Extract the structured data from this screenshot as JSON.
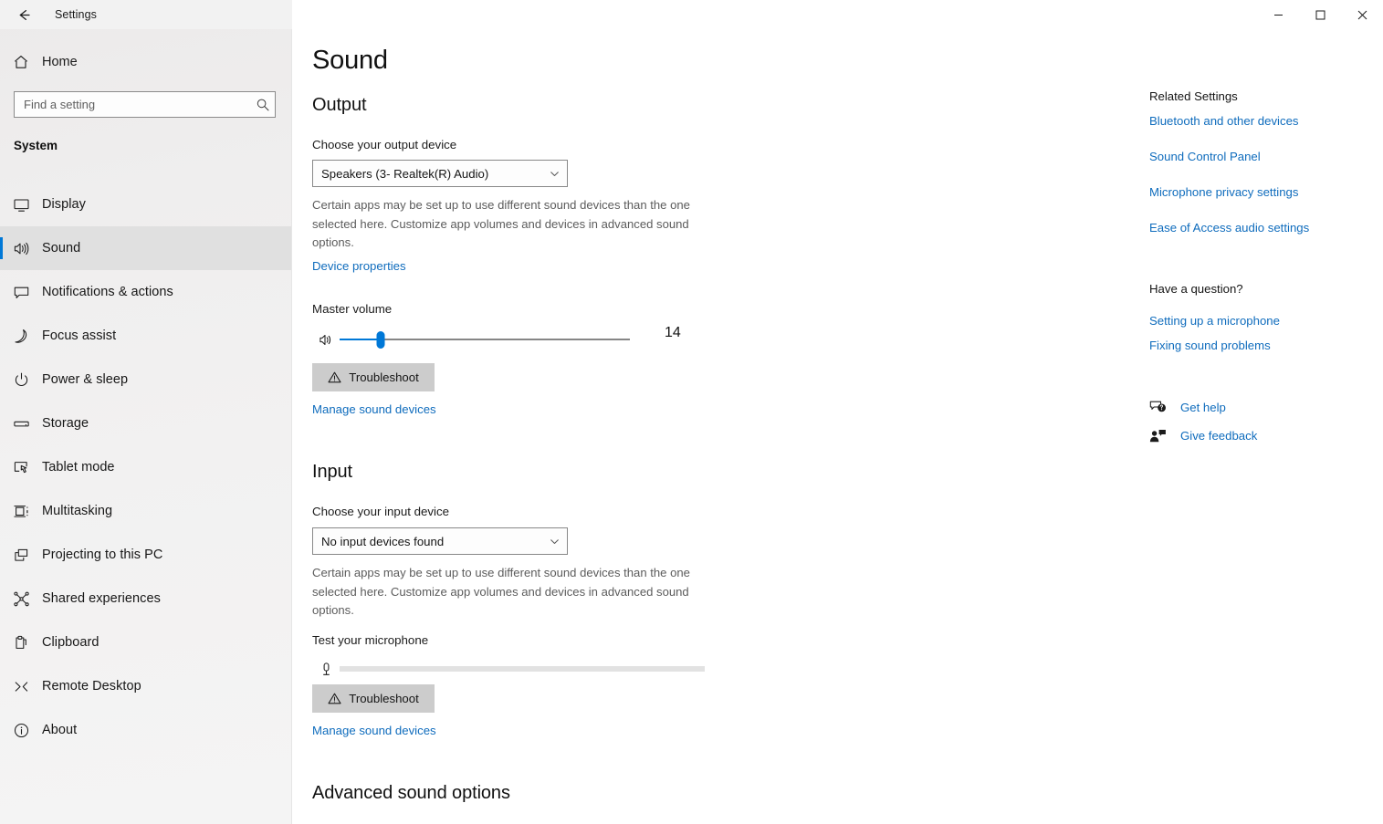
{
  "colors": {
    "accent": "#0078d7",
    "link": "#0f6cbd",
    "sidebar_bg": "#f1f0f0",
    "button_bg": "#cccccc",
    "body_bg": "#ffffff",
    "note_text": "#5c5c5c"
  },
  "titlebar": {
    "title": "Settings",
    "back_icon": "back-arrow-icon",
    "minimize_icon": "minimize-icon",
    "maximize_icon": "maximize-icon",
    "close_icon": "close-icon"
  },
  "sidebar": {
    "home_label": "Home",
    "home_icon": "home-icon",
    "search": {
      "placeholder": "Find a setting",
      "value": "",
      "icon": "search-icon"
    },
    "section_title": "System",
    "items": [
      {
        "label": "Display",
        "icon": "monitor-icon",
        "selected": false
      },
      {
        "label": "Sound",
        "icon": "speaker-icon",
        "selected": true
      },
      {
        "label": "Notifications & actions",
        "icon": "chat-bubble-icon",
        "selected": false
      },
      {
        "label": "Focus assist",
        "icon": "moon-icon",
        "selected": false
      },
      {
        "label": "Power & sleep",
        "icon": "power-icon",
        "selected": false
      },
      {
        "label": "Storage",
        "icon": "drive-icon",
        "selected": false
      },
      {
        "label": "Tablet mode",
        "icon": "tablet-touch-icon",
        "selected": false
      },
      {
        "label": "Multitasking",
        "icon": "multitasking-icon",
        "selected": false
      },
      {
        "label": "Projecting to this PC",
        "icon": "project-screen-icon",
        "selected": false
      },
      {
        "label": "Shared experiences",
        "icon": "share-nodes-icon",
        "selected": false
      },
      {
        "label": "Clipboard",
        "icon": "clipboard-icon",
        "selected": false
      },
      {
        "label": "Remote Desktop",
        "icon": "remote-desktop-icon",
        "selected": false
      },
      {
        "label": "About",
        "icon": "info-icon",
        "selected": false
      }
    ]
  },
  "main": {
    "page_title": "Sound",
    "output": {
      "heading": "Output",
      "device_label": "Choose your output device",
      "device_value": "Speakers (3- Realtek(R) Audio)",
      "device_arrow_icon": "chevron-down-icon",
      "note": "Certain apps may be set up to use different sound devices than the one selected here. Customize app volumes and devices in advanced sound options.",
      "device_properties_link": "Device properties",
      "volume_label": "Master volume",
      "volume_icon": "speaker-icon",
      "volume_value": "14",
      "volume_percent": 14,
      "troubleshoot_label": "Troubleshoot",
      "troubleshoot_icon": "warning-triangle-icon",
      "manage_link": "Manage sound devices"
    },
    "input": {
      "heading": "Input",
      "device_label": "Choose your input device",
      "device_value": "No input devices found",
      "device_arrow_icon": "chevron-down-icon",
      "note": "Certain apps may be set up to use different sound devices than the one selected here. Customize app volumes and devices in advanced sound options.",
      "test_label": "Test your microphone",
      "test_icon": "microphone-icon",
      "test_level_percent": 0,
      "troubleshoot_label": "Troubleshoot",
      "troubleshoot_icon": "warning-triangle-icon",
      "manage_link": "Manage sound devices"
    },
    "advanced_heading": "Advanced sound options"
  },
  "rail": {
    "related_heading": "Related Settings",
    "related_links": [
      "Bluetooth and other devices",
      "Sound Control Panel",
      "Microphone privacy settings",
      "Ease of Access audio settings"
    ],
    "question_heading": "Have a question?",
    "question_links": [
      "Setting up a microphone",
      "Fixing sound problems"
    ],
    "support": [
      {
        "label": "Get help",
        "icon": "help-bubble-icon"
      },
      {
        "label": "Give feedback",
        "icon": "feedback-person-icon"
      }
    ]
  }
}
